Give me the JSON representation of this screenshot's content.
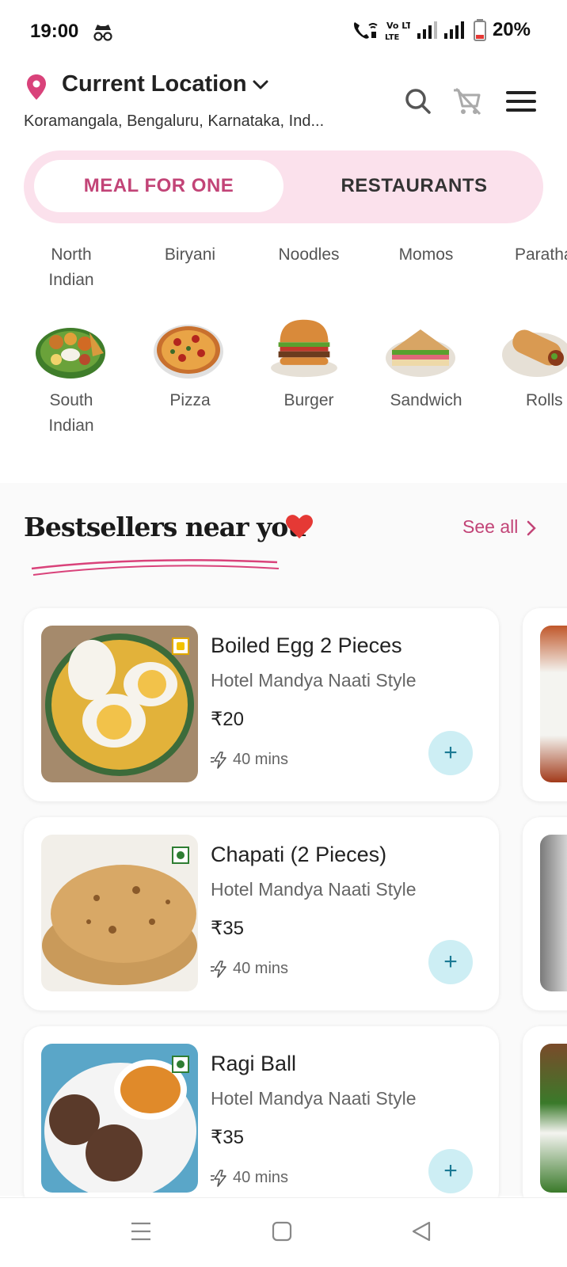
{
  "status_bar": {
    "time": "19:00",
    "battery": "20%",
    "network": "Vo LTE"
  },
  "header": {
    "location_title": "Current Location",
    "location_address": "Koramangala, Bengaluru, Karnataka, Ind...",
    "icons": [
      "search-icon",
      "cart-icon",
      "menu-icon"
    ]
  },
  "toggle": {
    "active_label": "MEAL FOR ONE",
    "inactive_label": "RESTAURANTS"
  },
  "categories": [
    {
      "label": "North\nIndian"
    },
    {
      "label": "Biryani"
    },
    {
      "label": "Noodles"
    },
    {
      "label": "Momos"
    },
    {
      "label": "Paratha"
    },
    {
      "label": "South\nIndian"
    },
    {
      "label": "Pizza"
    },
    {
      "label": "Burger"
    },
    {
      "label": "Sandwich"
    },
    {
      "label": "Rolls"
    }
  ],
  "bestsellers": {
    "title": "Bestsellers near you",
    "see_all": "See all",
    "items": [
      {
        "name": "Boiled Egg 2 Pieces",
        "restaurant": "Hotel Mandya Naati Style",
        "price": "₹20",
        "time": "40 mins",
        "type": "egg"
      },
      {
        "name": "Chapati (2 Pieces)",
        "restaurant": "Hotel Mandya Naati Style",
        "price": "₹35",
        "time": "40 mins",
        "type": "veg"
      },
      {
        "name": "Ragi Ball",
        "restaurant": "Hotel Mandya Naati Style",
        "price": "₹35",
        "time": "40 mins",
        "type": "veg"
      }
    ]
  },
  "colors": {
    "accent": "#c24477",
    "toggle_bg": "#fbe1ec",
    "add_btn": "#cdeef4"
  }
}
